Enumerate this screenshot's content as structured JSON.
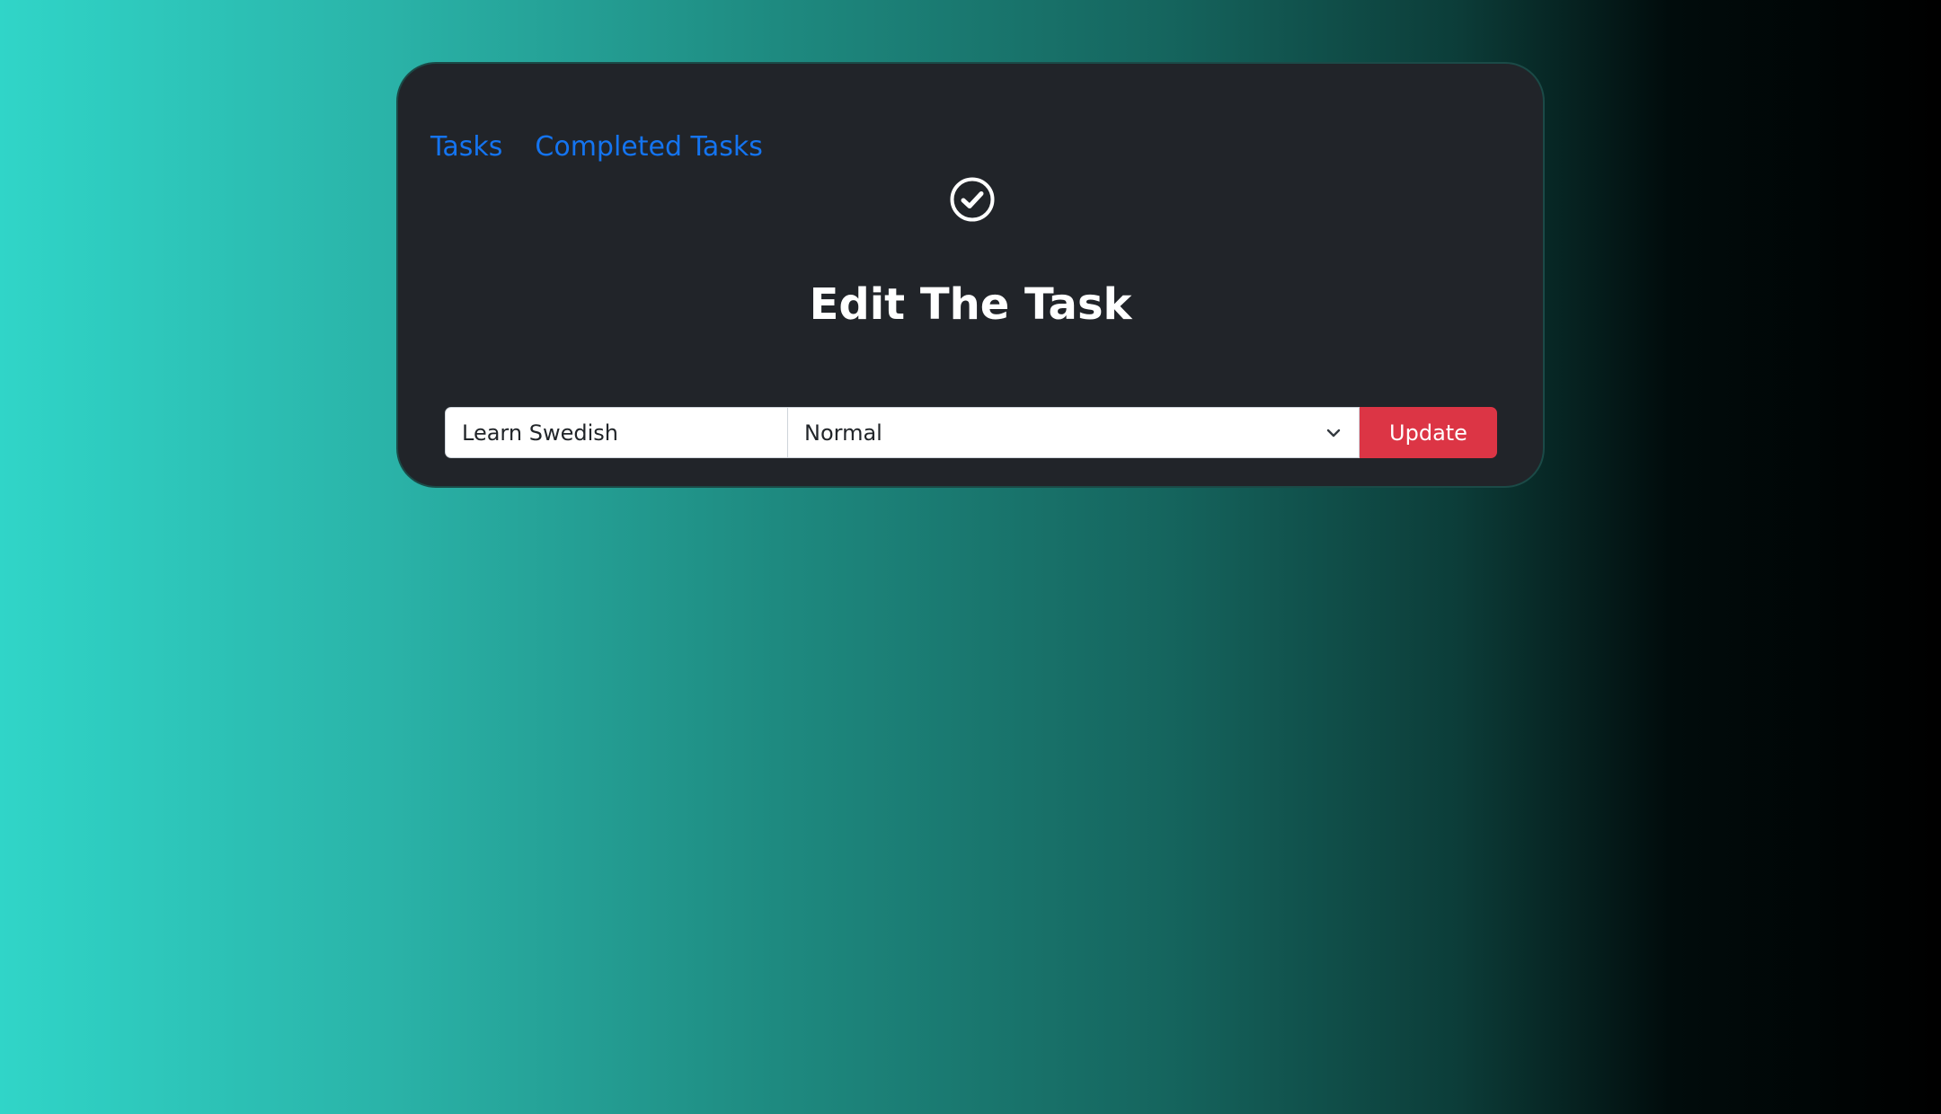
{
  "nav": {
    "items": [
      {
        "label": "Tasks"
      },
      {
        "label": "Completed Tasks"
      }
    ]
  },
  "header": {
    "icon": "check-circle-icon",
    "title": "Edit The Task"
  },
  "form": {
    "task_value": "Learn Swedish",
    "priority_selected": "Normal",
    "update_label": "Update"
  },
  "colors": {
    "link": "#1474f0",
    "card_background": "#212429",
    "update_button": "#dc3545",
    "gradient_start": "#30d5c8",
    "gradient_end": "#000000"
  }
}
